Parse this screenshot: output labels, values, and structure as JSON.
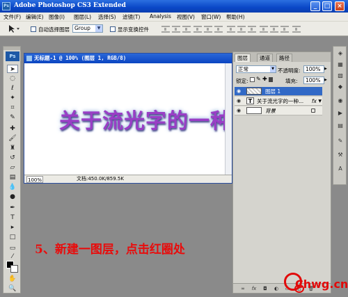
{
  "app": {
    "title": "Adobe Photoshop CS3 Extended",
    "icon": "photoshop-icon"
  },
  "window_buttons": [
    "_",
    "□",
    "×"
  ],
  "menu": [
    "文件(F)",
    "编辑(E)",
    "图像(I)",
    "图层(L)",
    "选择(S)",
    "滤镜(T)",
    "Analysis",
    "视图(V)",
    "窗口(W)",
    "帮助(H)"
  ],
  "options": {
    "auto_select_label": "自动选择图层",
    "group_value": "Group",
    "show_transform_label": "显示变换控件"
  },
  "toolbox": {
    "logo": "Ps",
    "tools": [
      "move-tool-icon",
      "marquee-tool-icon",
      "lasso-tool-icon",
      "magic-wand-icon",
      "crop-tool-icon",
      "slice-tool-icon",
      "healing-brush-icon",
      "brush-tool-icon",
      "clone-stamp-icon",
      "history-brush-icon",
      "eraser-icon",
      "gradient-icon",
      "blur-tool-icon",
      "dodge-tool-icon",
      "pen-tool-icon",
      "type-tool-icon",
      "path-selection-icon",
      "shape-tool-icon",
      "notes-tool-icon",
      "eyedropper-icon",
      "hand-tool-icon",
      "zoom-tool-icon"
    ]
  },
  "document": {
    "title": "无标题-1 @ 100% (图层 1, RGB/8)",
    "canvas_text": "关于流光字的一种",
    "zoom": "100%",
    "doc_info": "文档:450.0K/859.5K"
  },
  "panel": {
    "tabs": [
      "图层",
      "通道",
      "路径"
    ],
    "blend_mode": "正常",
    "opacity_label": "不透明度:",
    "opacity_value": "100%",
    "lock_label": "锁定:",
    "fill_label": "填充:",
    "fill_value": "100%",
    "layers": [
      {
        "name": "图层 1",
        "selected": true,
        "type": "raster"
      },
      {
        "name": "关于流光字的一种...",
        "selected": false,
        "type": "text",
        "fx": "fx"
      },
      {
        "name": "背景",
        "selected": false,
        "type": "background"
      }
    ]
  },
  "caption": "5、新建一图层，点击红圈处",
  "watermark": "Chwg.cn",
  "colors": {
    "caption": "#e80c0c",
    "titlebar": "#0a47c7",
    "selected_layer": "#3169c6"
  }
}
